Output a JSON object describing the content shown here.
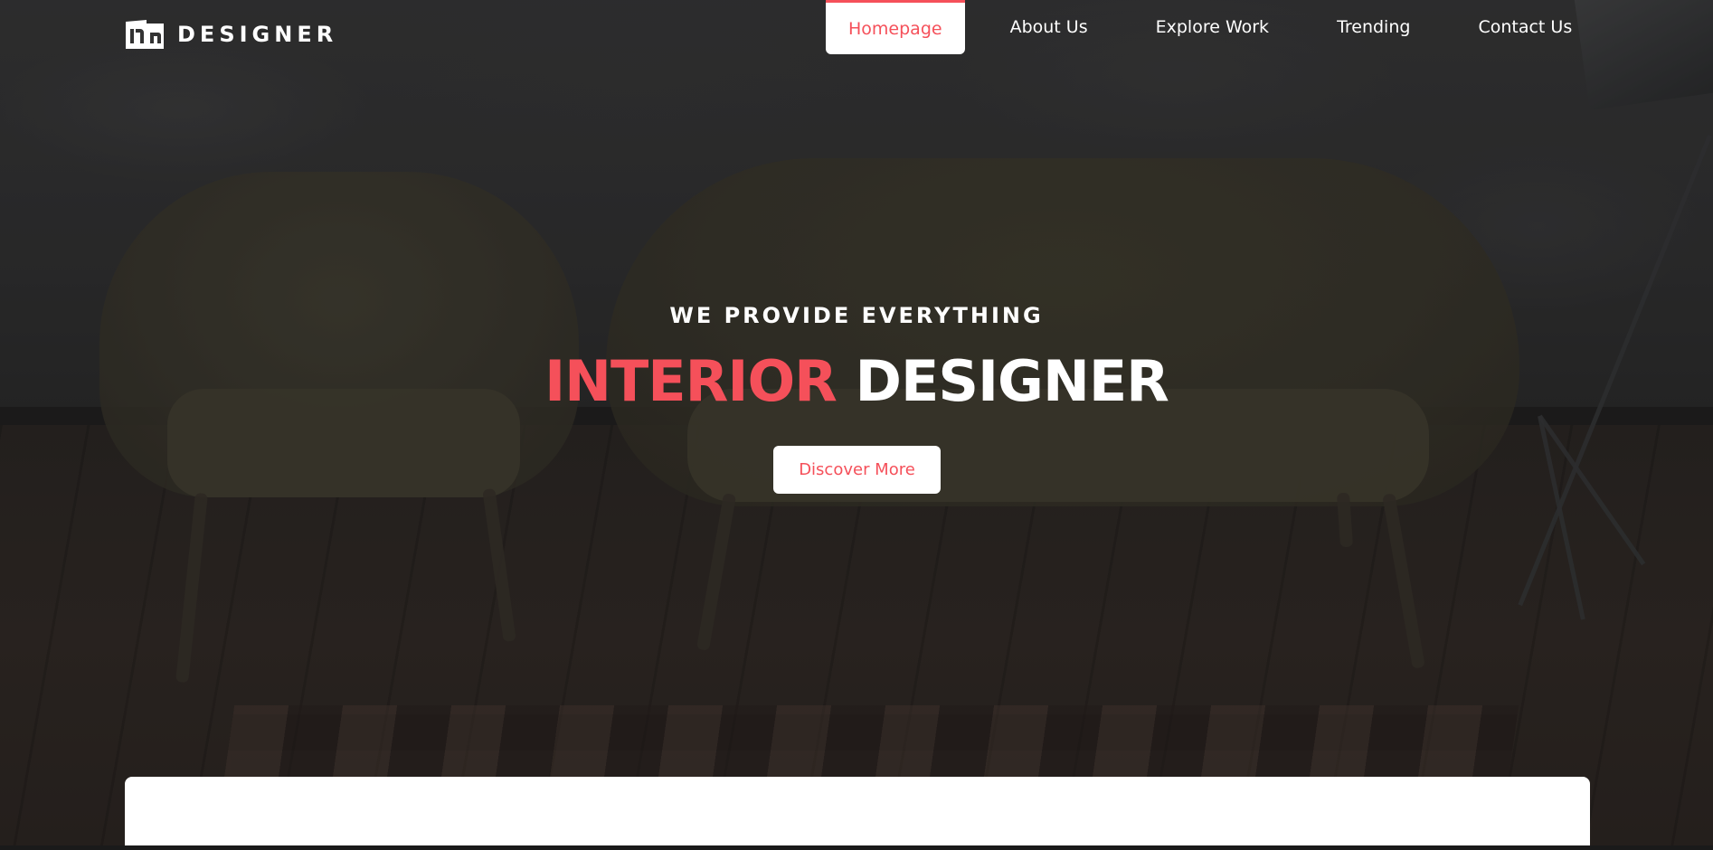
{
  "brand": {
    "name": "DESIGNER",
    "logo_icon": "dn-monogram-icon"
  },
  "nav": {
    "items": [
      {
        "label": "Homepage",
        "active": true
      },
      {
        "label": "About Us",
        "active": false
      },
      {
        "label": "Explore Work",
        "active": false
      },
      {
        "label": "Trending",
        "active": false
      },
      {
        "label": "Contact Us",
        "active": false
      }
    ]
  },
  "hero": {
    "tagline": "WE PROVIDE EVERYTHING",
    "headline_accent": "INTERIOR",
    "headline_rest": "DESIGNER",
    "cta_label": "Discover More"
  },
  "colors": {
    "accent": "#f5505a",
    "white": "#ffffff",
    "background": "#2b2b2b"
  }
}
